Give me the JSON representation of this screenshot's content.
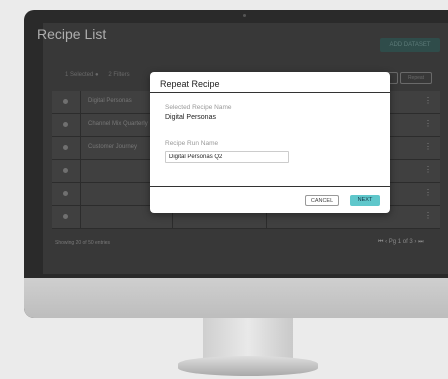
{
  "app": {
    "title": "Recipe List",
    "add_button": "ADD DATASET",
    "toolbar": {
      "selected": "1 Selected ●",
      "filters": "2 Filters",
      "btn_a": "",
      "btn_repeat": "Repeat"
    }
  },
  "table": {
    "rows": [
      {
        "name": "Digital Personas",
        "menu": "⋮"
      },
      {
        "name": "Channel Mix Quarterly",
        "menu": "⋮"
      },
      {
        "name": "Customer Journey",
        "menu": "⋮"
      },
      {
        "name": "",
        "menu": "⋮"
      },
      {
        "name": "",
        "menu": "⋮"
      },
      {
        "name": "",
        "menu": "⋮"
      }
    ],
    "footer_left": "Showing 20 of 50 entries",
    "pagination": "⏮ ‹ Pg 1 of 3 › ⏭"
  },
  "modal": {
    "title": "Repeat Recipe",
    "selected_label": "Selected Recipe Name",
    "selected_value": "Digital Personas",
    "run_label": "Recipe Run Name",
    "run_value": "Digital Personas Q2",
    "cancel_label": "CANCEL",
    "next_label": "NEXT"
  },
  "colors": {
    "accent": "#5fc7cb",
    "screen_bg": "#383838"
  }
}
